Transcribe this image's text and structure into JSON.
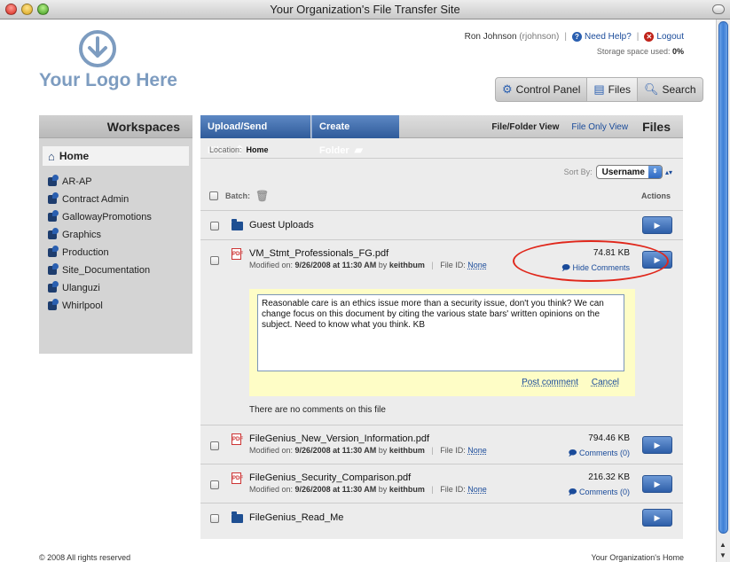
{
  "window": {
    "title": "Your Organization's File Transfer Site"
  },
  "logo": {
    "text": "Your Logo Here",
    "icon": "download-circle-icon",
    "color": "#7d9cc0"
  },
  "user": {
    "name": "Ron Johnson",
    "username": "(rjohnson)",
    "help_label": "Need Help?",
    "logout_label": "Logout",
    "storage_label": "Storage space used:",
    "storage_value": "0%"
  },
  "nav": {
    "tabs": [
      {
        "label": "Control Panel",
        "icon": "gear-icon"
      },
      {
        "label": "Files",
        "icon": "file-icon"
      },
      {
        "label": "Search",
        "icon": "search-icon"
      }
    ],
    "active": "Files"
  },
  "sidebar": {
    "title": "Workspaces",
    "home": "Home",
    "items": [
      "AR-AP",
      "Contract Admin",
      "GallowayPromotions",
      "Graphics",
      "Production",
      "Site_Documentation",
      "Ulanguzi",
      "Whirlpool"
    ]
  },
  "toolbar": {
    "upload_label": "Upload/Send Files",
    "create_folder_label": "Create Folder",
    "view_folder": "File/Folder View",
    "view_files_only": "File Only View",
    "section_title": "Files"
  },
  "location": {
    "label": "Location:",
    "value": "Home"
  },
  "sort": {
    "label": "Sort By:",
    "value": "Username"
  },
  "batch_label": "Batch:",
  "actions_label": "Actions",
  "files": [
    {
      "type": "folder",
      "name": "Guest Uploads"
    },
    {
      "type": "pdf",
      "name": "VM_Stmt_Professionals_FG.pdf",
      "modified_prefix": "Modified on:",
      "modified": "9/26/2008 at 11:30 AM",
      "by": "by",
      "user": "keithbum",
      "fileid_label": "File ID:",
      "fileid": "None",
      "size": "74.81 KB",
      "comments": "Hide Comments"
    },
    {
      "type": "pdf",
      "name": "FileGenius_New_Version_Information.pdf",
      "modified_prefix": "Modified on:",
      "modified": "9/26/2008 at 11:30 AM",
      "by": "by",
      "user": "keithbum",
      "fileid_label": "File ID:",
      "fileid": "None",
      "size": "794.46 KB",
      "comments": "Comments (0)"
    },
    {
      "type": "pdf",
      "name": "FileGenius_Security_Comparison.pdf",
      "modified_prefix": "Modified on:",
      "modified": "9/26/2008 at 11:30 AM",
      "by": "by",
      "user": "keithbum",
      "fileid_label": "File ID:",
      "fileid": "None",
      "size": "216.32 KB",
      "comments": "Comments (0)"
    },
    {
      "type": "folder",
      "name": "FileGenius_Read_Me"
    }
  ],
  "comment": {
    "text": "Reasonable care is an ethics issue more than a security issue, don't you think? We can change focus on this document by citing the various state bars' written opinions on the subject. Need to know what you think. KB",
    "post_label": "Post comment",
    "cancel_label": "Cancel",
    "empty_message": "There are no comments on this file"
  },
  "footer": {
    "copyright": "© 2008 All rights reserved",
    "home_link": "Your Organization's Home"
  },
  "colors": {
    "accent": "#2f5b9a",
    "annotation": "#e0271b",
    "comment_bg": "#fefdc6"
  }
}
